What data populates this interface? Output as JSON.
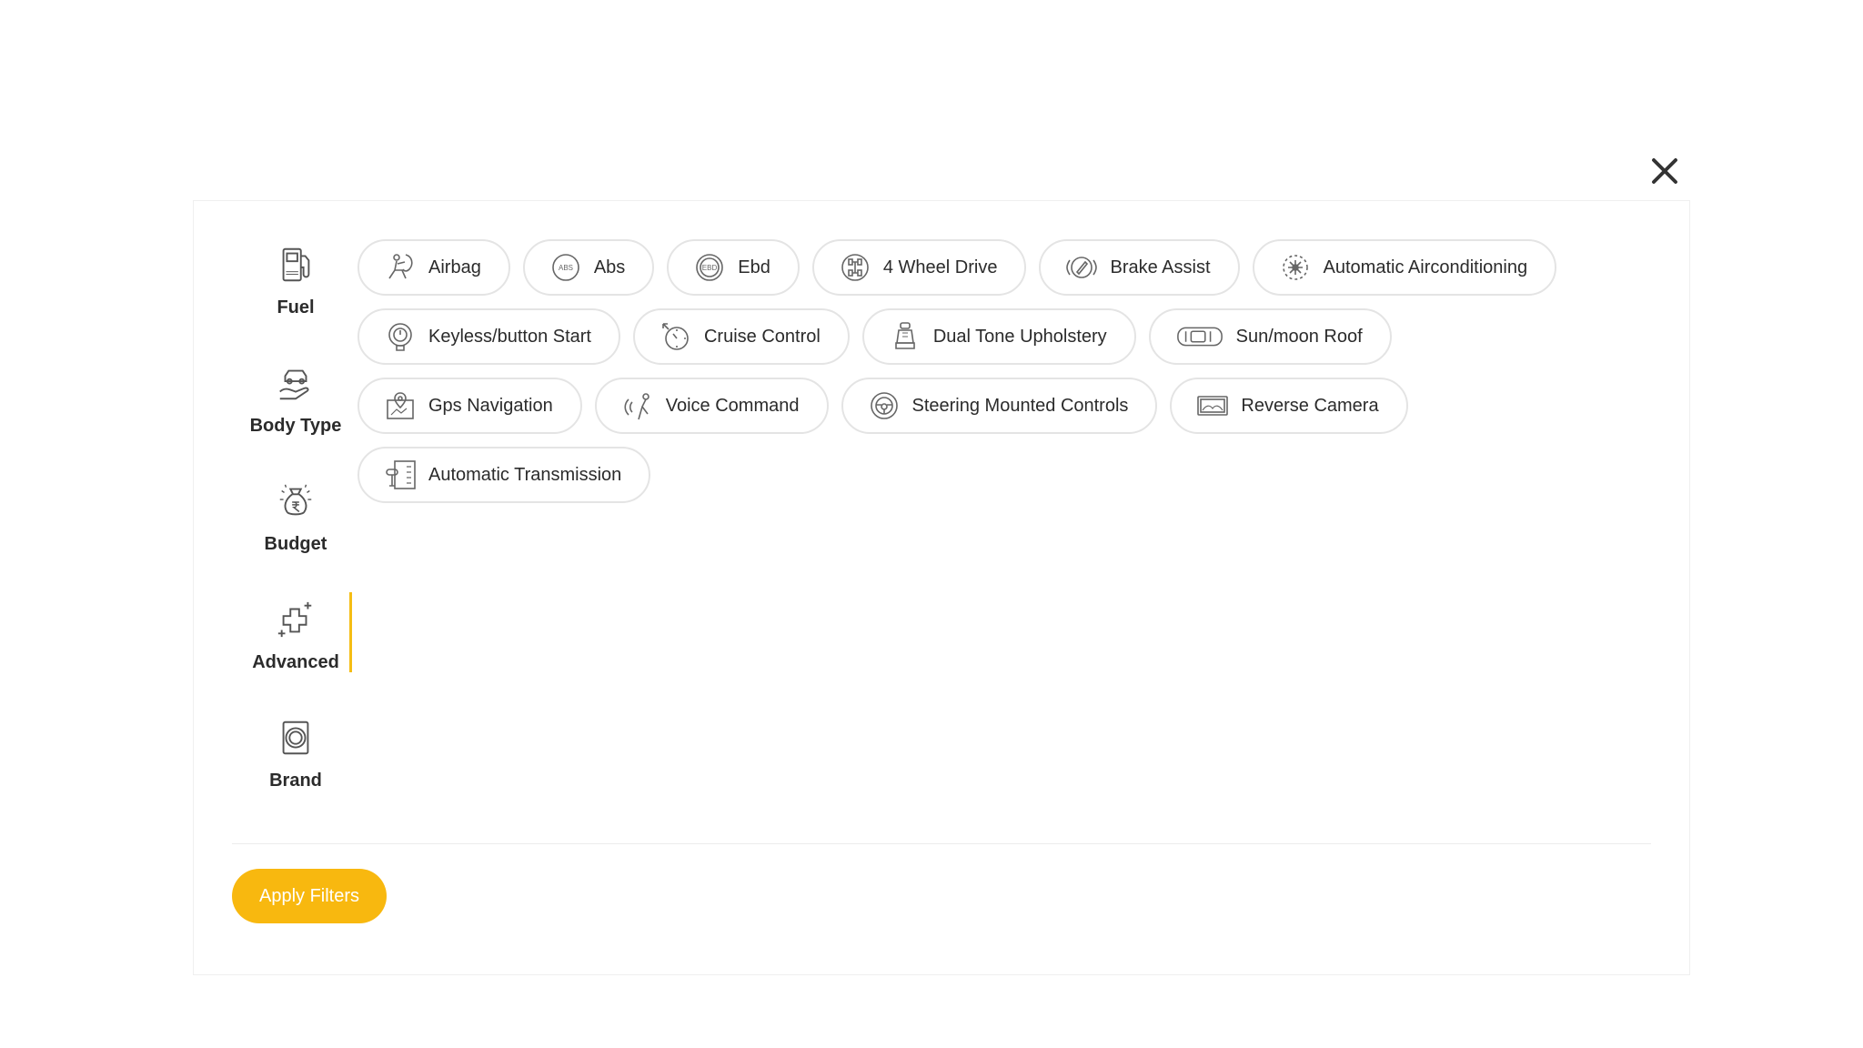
{
  "close": {
    "icon": "close-icon"
  },
  "sidebar": {
    "items": [
      {
        "label": "Fuel",
        "icon": "fuel-pump-icon",
        "active": false
      },
      {
        "label": "Body Type",
        "icon": "car-hand-icon",
        "active": false
      },
      {
        "label": "Budget",
        "icon": "money-bag-icon",
        "active": false
      },
      {
        "label": "Advanced",
        "icon": "plus-sparkle-icon",
        "active": true
      },
      {
        "label": "Brand",
        "icon": "brand-emblem-icon",
        "active": false
      }
    ]
  },
  "features": {
    "rows": [
      [
        {
          "label": "Airbag",
          "icon": "airbag-icon"
        },
        {
          "label": "Abs",
          "icon": "abs-icon",
          "text": "ABS"
        },
        {
          "label": "Ebd",
          "icon": "ebd-icon",
          "text": "EBD"
        },
        {
          "label": "4 Wheel Drive",
          "icon": "four-wheel-drive-icon"
        },
        {
          "label": "Brake Assist",
          "icon": "brake-assist-icon"
        },
        {
          "label": "Automatic Airconditioning",
          "icon": "air-conditioning-icon"
        }
      ],
      [
        {
          "label": "Keyless/button Start",
          "icon": "keyless-start-icon"
        },
        {
          "label": "Cruise Control",
          "icon": "cruise-control-icon"
        },
        {
          "label": "Dual Tone Upholstery",
          "icon": "car-seat-icon"
        },
        {
          "label": "Sun/moon Roof",
          "icon": "sunroof-icon"
        }
      ],
      [
        {
          "label": "Gps Navigation",
          "icon": "gps-navigation-icon"
        },
        {
          "label": "Voice Command",
          "icon": "voice-command-icon"
        },
        {
          "label": "Steering Mounted Controls",
          "icon": "steering-wheel-icon"
        },
        {
          "label": "Reverse Camera",
          "icon": "reverse-camera-icon"
        }
      ],
      [
        {
          "label": "Automatic Transmission",
          "icon": "automatic-transmission-icon"
        }
      ]
    ]
  },
  "footer": {
    "apply_label": "Apply Filters"
  },
  "colors": {
    "accent": "#f8b80f",
    "active_bar": "#f5bd14",
    "chip_border": "#e4e4e4"
  }
}
